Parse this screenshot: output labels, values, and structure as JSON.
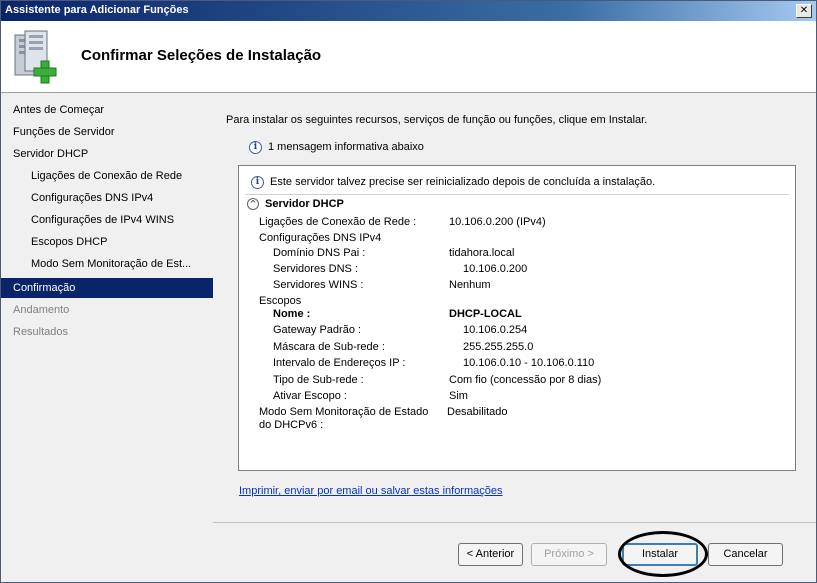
{
  "window": {
    "title": "Assistente para Adicionar Funções",
    "close_glyph": "✕"
  },
  "header": {
    "title": "Confirmar Seleções de Instalação",
    "icon": "server-add-icon"
  },
  "sidebar": {
    "items": [
      {
        "label": "Antes de Começar",
        "state": "normal"
      },
      {
        "label": "Funções de Servidor",
        "state": "normal"
      },
      {
        "label": "Servidor DHCP",
        "state": "normal"
      },
      {
        "label": "Ligações de Conexão de Rede",
        "state": "sub"
      },
      {
        "label": "Configurações DNS IPv4",
        "state": "sub"
      },
      {
        "label": "Configurações de IPv4 WINS",
        "state": "sub"
      },
      {
        "label": "Escopos DHCP",
        "state": "sub"
      },
      {
        "label": "Modo Sem Monitoração de Est...",
        "state": "sub"
      },
      {
        "label": "Confirmação",
        "state": "active"
      },
      {
        "label": "Andamento",
        "state": "disabled"
      },
      {
        "label": "Resultados",
        "state": "disabled"
      }
    ]
  },
  "main": {
    "intro": "Para instalar os seguintes recursos, serviços de função ou funções, clique em Instalar.",
    "info_message": "1 mensagem informativa abaixo",
    "warning": "Este servidor talvez precise ser reinicializado depois de concluída a instalação.",
    "section_title": "Servidor DHCP",
    "details": [
      {
        "label": "Ligações de Conexão de Rede :",
        "value": "10.106.0.200 (IPv4)",
        "indent": 0
      },
      {
        "label": "Configurações DNS IPv4",
        "value": "",
        "indent": 0
      },
      {
        "label": "Domínio DNS Pai :",
        "value": "tidahora.local",
        "indent": 1
      },
      {
        "label": "Servidores DNS :",
        "value": "10.106.0.200",
        "indent": 1
      },
      {
        "label": "Servidores WINS :",
        "value": "Nenhum",
        "indent": 1
      },
      {
        "label": "Escopos",
        "value": "",
        "indent": 0
      },
      {
        "label": "Nome :",
        "value": "DHCP-LOCAL",
        "indent": 1,
        "bold": true
      },
      {
        "label": "Gateway Padrão :",
        "value": "10.106.0.254",
        "indent": 1
      },
      {
        "label": "Máscara de Sub-rede :",
        "value": "255.255.255.0",
        "indent": 1
      },
      {
        "label": "Intervalo de Endereços IP :",
        "value": "10.106.0.10 - 10.106.0.110",
        "indent": 1
      },
      {
        "label": "Tipo de Sub-rede :",
        "value": "Com fio (concessão por 8 dias)",
        "indent": 1
      },
      {
        "label": "Ativar Escopo :",
        "value": "Sim",
        "indent": 1
      },
      {
        "label": "Modo Sem Monitoração de Estado",
        "label2": "do DHCPv6 :",
        "value": "Desabilitado",
        "indent": 0
      }
    ],
    "print_link": "Imprimir, enviar por email ou salvar estas informações"
  },
  "footer": {
    "back_label": "< Anterior",
    "next_label": "Próximo >",
    "install_label": "Instalar",
    "cancel_label": "Cancelar"
  }
}
